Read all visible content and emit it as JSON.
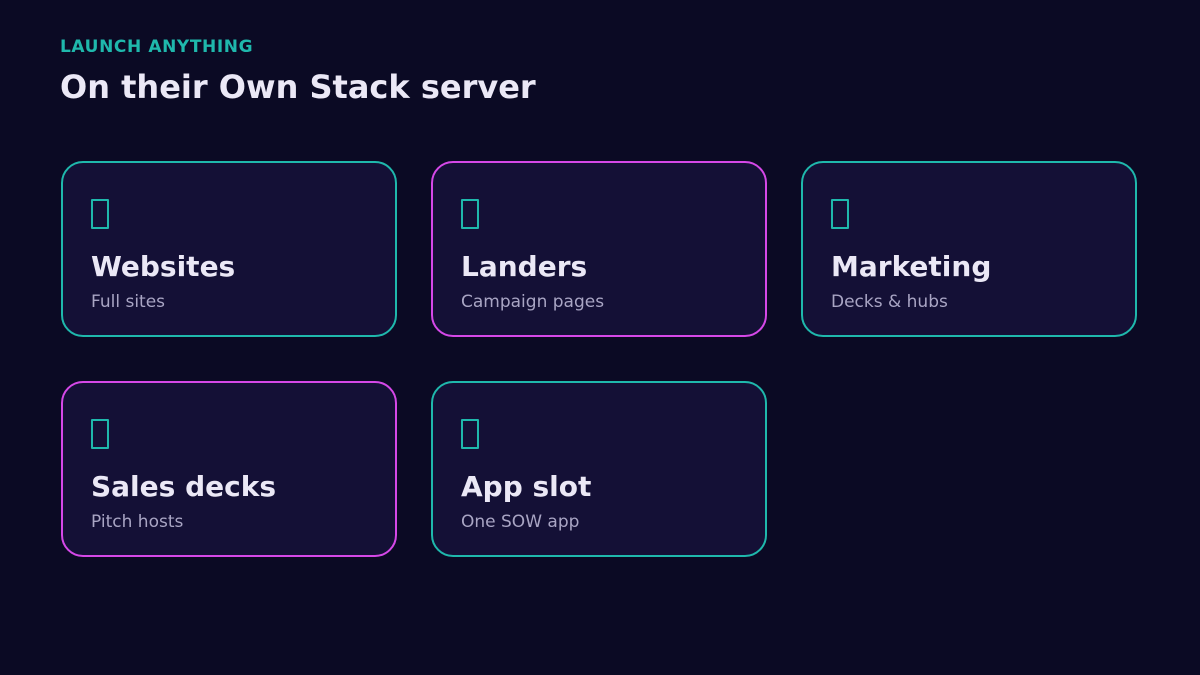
{
  "header": {
    "eyebrow": "LAUNCH ANYTHING",
    "title": "On their Own Stack server"
  },
  "colors": {
    "background": "#0b0a24",
    "card_background": "#141036",
    "teal_accent": "#1fb8ac",
    "magenta_accent": "#d548e8",
    "title_text": "#ebe8f6",
    "subtitle_text": "#a9a5c4"
  },
  "cards": [
    {
      "title": "Websites",
      "subtitle": "Full sites",
      "accent": "teal",
      "icon": "missing-glyph-icon"
    },
    {
      "title": "Landers",
      "subtitle": "Campaign pages",
      "accent": "magenta",
      "icon": "missing-glyph-icon"
    },
    {
      "title": "Marketing",
      "subtitle": "Decks & hubs",
      "accent": "teal",
      "icon": "missing-glyph-icon"
    },
    {
      "title": "Sales decks",
      "subtitle": "Pitch hosts",
      "accent": "magenta",
      "icon": "missing-glyph-icon"
    },
    {
      "title": "App slot",
      "subtitle": "One SOW app",
      "accent": "teal",
      "icon": "missing-glyph-icon"
    }
  ]
}
